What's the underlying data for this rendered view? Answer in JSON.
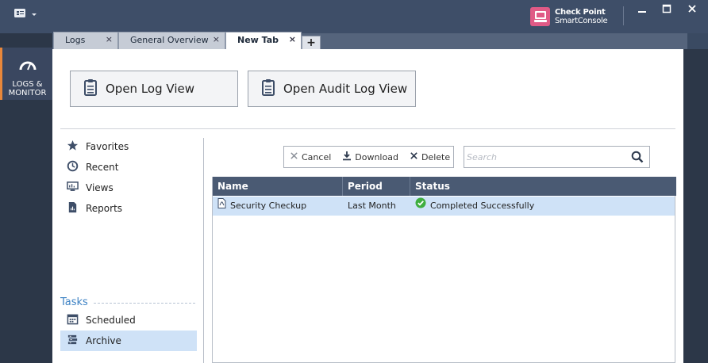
{
  "window": {
    "brand_line1": "Check Point",
    "brand_line2": "SmartConsole"
  },
  "rail": {
    "item_label_1": "LOGS &",
    "item_label_2": "MONITOR"
  },
  "tabs": [
    {
      "label": "Logs",
      "active": false
    },
    {
      "label": "General Overview",
      "active": false
    },
    {
      "label": "New Tab",
      "active": true
    }
  ],
  "tab_add_label": "+",
  "tab_close_label": "×",
  "actions": {
    "open_log_view": "Open Log View",
    "open_audit_log_view": "Open Audit Log View"
  },
  "nav": {
    "items": [
      {
        "label": "Favorites",
        "icon": "star-icon"
      },
      {
        "label": "Recent",
        "icon": "clock-icon"
      },
      {
        "label": "Views",
        "icon": "monitor-icon"
      },
      {
        "label": "Reports",
        "icon": "report-icon"
      }
    ]
  },
  "tasks": {
    "title": "Tasks",
    "items": [
      {
        "label": "Scheduled",
        "icon": "calendar-icon",
        "selected": false
      },
      {
        "label": "Archive",
        "icon": "archive-icon",
        "selected": true
      }
    ]
  },
  "toolbar": {
    "cancel_label": "Cancel",
    "download_label": "Download",
    "delete_label": "Delete"
  },
  "search": {
    "placeholder": "Search",
    "value": ""
  },
  "table": {
    "columns": [
      "Name",
      "Period",
      "Status"
    ],
    "rows": [
      {
        "name": "Security Checkup",
        "period": "Last Month",
        "status": "Completed Successfully"
      }
    ]
  },
  "colors": {
    "accent": "#3d82c4",
    "selection": "#cfe2f7",
    "header": "#4a5a73",
    "success": "#3fae3f",
    "brand": "#e05a86",
    "rail_accent": "#e8873a"
  }
}
